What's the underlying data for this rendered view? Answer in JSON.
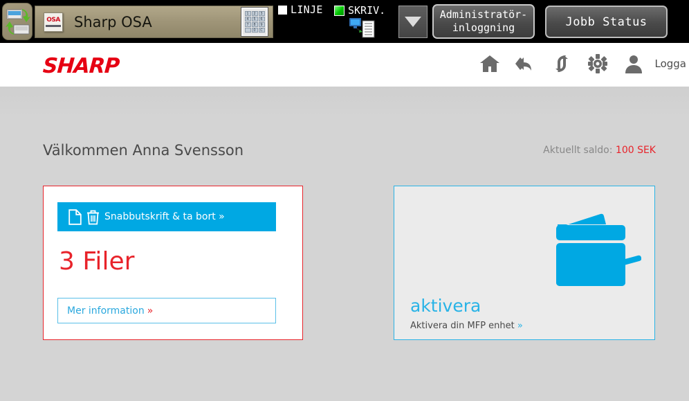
{
  "panel": {
    "exchange_icon": "data-exchange-icon",
    "app_title": "Sharp OSA",
    "osa_logo_word": "OSA",
    "keypad_keys": [
      "1",
      "2",
      "3",
      "4",
      "5",
      "6",
      "7",
      "8",
      "9",
      "",
      "0",
      "C"
    ],
    "status_line_label": "LINJE",
    "status_print_label": "SKRIV.",
    "dropdown_icon": "chevron-down-icon",
    "admin_login_line1": "Administratör-",
    "admin_login_line2": "inloggning",
    "job_status_label": "Jobb Status"
  },
  "header": {
    "brand": "SHARP",
    "icons": [
      "home-icon",
      "reply-back-icon",
      "refresh-swap-icon",
      "gear-icon",
      "user-icon"
    ],
    "logout_label": "Logga"
  },
  "main": {
    "welcome": "Välkommen Anna Svensson",
    "balance_label": "Aktuellt saldo:",
    "balance_amount": "100 SEK",
    "files_card": {
      "banner_label": "Snabbutskrift & ta bort »",
      "count_label": "3 Filer",
      "more_info_label": "Mer information",
      "more_info_chevron": "»"
    },
    "activate_card": {
      "title": "aktivera",
      "subtitle": "Aktivera din MFP enhet",
      "subtitle_chevron": "»"
    }
  },
  "colors": {
    "brand_red": "#e60013",
    "accent_red": "#e8232a",
    "accent_blue": "#00a8e3",
    "light_blue": "#29b3e6",
    "page_bg": "#d4d4d4"
  }
}
